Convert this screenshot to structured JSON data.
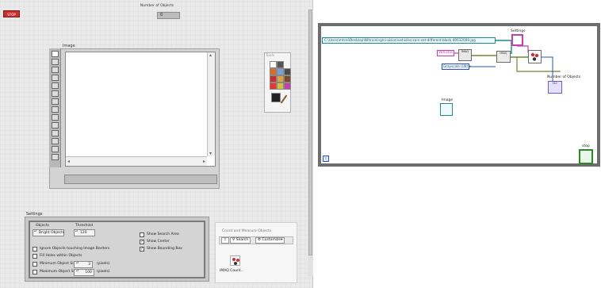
{
  "front_panel": {
    "stop_button": "STOP",
    "number_of_objects": {
      "label": "Number of Objects",
      "value": "0"
    },
    "image": {
      "label": "Image"
    },
    "tools_palette": {
      "title": "Tools"
    },
    "settings": {
      "label": "Settings",
      "objects": {
        "label": "Objects",
        "value": "Bright Objects"
      },
      "threshold": {
        "label": "Threshold",
        "value": "120"
      },
      "ignore_border": "Ignore Objects touching Image Borders",
      "fill_holes": "Fill Holes within Objects",
      "min_size": {
        "label": "Minimum Object Size",
        "value": "3",
        "unit": "(pixels)"
      },
      "max_size": {
        "label": "Maximum Object Size",
        "value": "100",
        "unit": "(pixels)"
      },
      "show_search_area": "Show Search Area",
      "show_center": "Show Center",
      "show_bounding_box": "Show Bounding Box",
      "checked": {
        "show_search_area": false,
        "show_center": true,
        "show_bounding_box": true,
        "ignore_border": false,
        "fill_holes": false,
        "min_size": false,
        "max_size": false
      }
    }
  },
  "express_palette": {
    "title": "Count and Measure Objects",
    "search_label": "Search",
    "customize_label": "Customize▾",
    "vi_label": "IMAQ Count..."
  },
  "block_diagram": {
    "path_constant": "C:\\Users\\mtcel\\Desktop\\NI\\training\\ni-vision\\vehicles-cars-set-different-black-40032009.jpg",
    "settings_label": "Settings",
    "vehicles_constant": "Vehicles",
    "grayscale_constant": "Grayscale (U8) ▾",
    "imaq_create_label": "IMAQ",
    "read_file_label": "IMAQ",
    "number_of_objects_label": "Number of Objects",
    "number_of_objects_value": "I32",
    "image_label": "Image",
    "stop_label": "stop",
    "loop_iteration": "i"
  }
}
